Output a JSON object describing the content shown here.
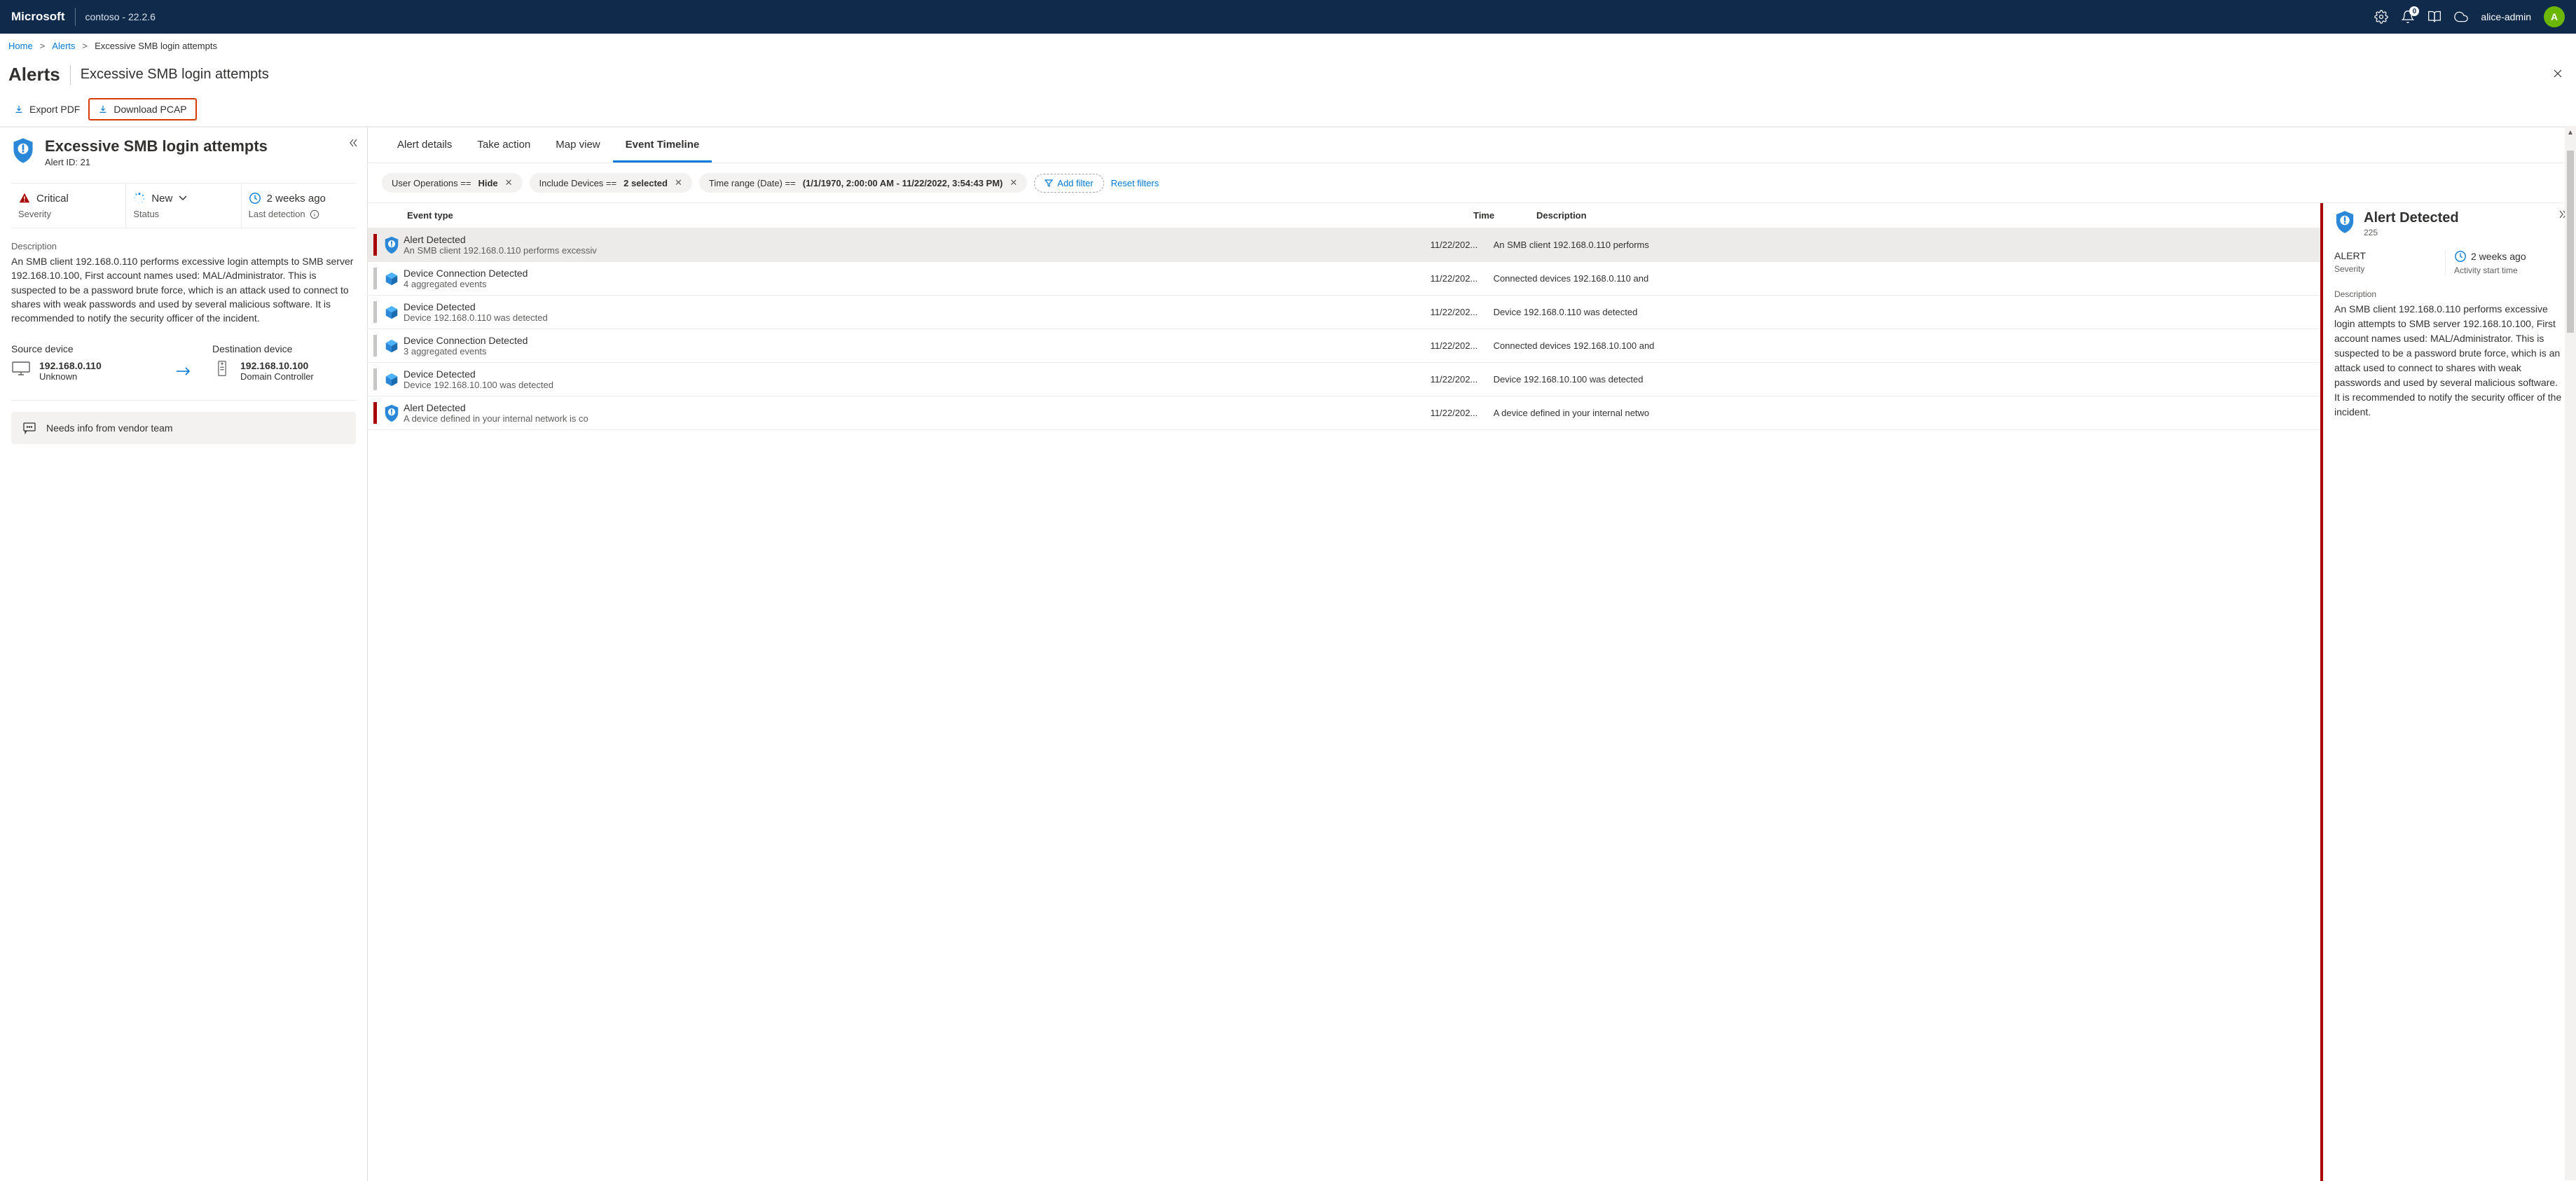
{
  "header": {
    "brand": "Microsoft",
    "tenant": "contoso - 22.2.6",
    "notification_count": "0",
    "user_name": "alice-admin",
    "user_initial": "A"
  },
  "breadcrumb": {
    "home": "Home",
    "alerts": "Alerts",
    "current": "Excessive SMB login attempts"
  },
  "page": {
    "title": "Alerts",
    "subtitle": "Excessive SMB login attempts"
  },
  "toolbar": {
    "export_pdf": "Export PDF",
    "download_pcap": "Download PCAP"
  },
  "alert": {
    "title": "Excessive SMB login attempts",
    "id_label": "Alert ID: 21",
    "severity_value": "Critical",
    "severity_label": "Severity",
    "status_value": "New",
    "status_label": "Status",
    "last_detection_value": "2 weeks ago",
    "last_detection_label": "Last detection",
    "description_label": "Description",
    "description": "An SMB client 192.168.0.110 performs excessive login attempts to SMB server 192.168.10.100, First account names used: MAL/Administrator. This is suspected to be a password brute force, which is an attack used to connect to shares with weak passwords and used by several malicious software. It is recommended to notify the security officer of the incident.",
    "source_label": "Source device",
    "source_ip": "192.168.0.110",
    "source_sub": "Unknown",
    "dest_label": "Destination device",
    "dest_ip": "192.168.10.100",
    "dest_sub": "Domain Controller",
    "comment": "Needs info from vendor team"
  },
  "tabs": {
    "details": "Alert details",
    "action": "Take action",
    "map": "Map view",
    "timeline": "Event Timeline"
  },
  "filters": {
    "f1_label": "User Operations ==",
    "f1_value": "Hide",
    "f2_label": "Include Devices ==",
    "f2_value": "2 selected",
    "f3_label": "Time range (Date)  ==",
    "f3_value": "(1/1/1970, 2:00:00 AM - 11/22/2022, 3:54:43 PM)",
    "add": "Add filter",
    "reset": "Reset filters"
  },
  "table": {
    "col_type": "Event type",
    "col_time": "Time",
    "col_desc": "Description",
    "rows": [
      {
        "title": "Alert Detected",
        "sub": "An SMB client 192.168.0.110 performs excessiv",
        "time": "11/22/202...",
        "desc": "An SMB client 192.168.0.110 performs",
        "kind": "alert",
        "sev": "red",
        "sel": true
      },
      {
        "title": "Device Connection Detected",
        "sub": "4 aggregated events",
        "time": "11/22/202...",
        "desc": "Connected devices 192.168.0.110 and",
        "kind": "device",
        "sev": "grey",
        "sel": false
      },
      {
        "title": "Device Detected",
        "sub": "Device 192.168.0.110 was detected",
        "time": "11/22/202...",
        "desc": "Device 192.168.0.110 was detected",
        "kind": "device",
        "sev": "grey",
        "sel": false
      },
      {
        "title": "Device Connection Detected",
        "sub": "3 aggregated events",
        "time": "11/22/202...",
        "desc": "Connected devices 192.168.10.100 and",
        "kind": "device",
        "sev": "grey",
        "sel": false
      },
      {
        "title": "Device Detected",
        "sub": "Device 192.168.10.100 was detected",
        "time": "11/22/202...",
        "desc": "Device 192.168.10.100 was detected",
        "kind": "device",
        "sev": "grey",
        "sel": false
      },
      {
        "title": "Alert Detected",
        "sub": "A device defined in your internal network is co",
        "time": "11/22/202...",
        "desc": "A device defined in your internal netwo",
        "kind": "alert",
        "sev": "red",
        "sel": false
      }
    ]
  },
  "detail": {
    "title": "Alert Detected",
    "count": "225",
    "severity_value": "ALERT",
    "severity_label": "Severity",
    "start_value": "2 weeks ago",
    "start_label": "Activity start time",
    "desc_label": "Description",
    "desc": "An SMB client 192.168.0.110 performs excessive login attempts to SMB server 192.168.10.100, First account names used: MAL/Administrator. This is suspected to be a password brute force, which is an attack used to connect to shares with weak passwords and used by several malicious software. It is recommended to notify the security officer of the incident."
  }
}
